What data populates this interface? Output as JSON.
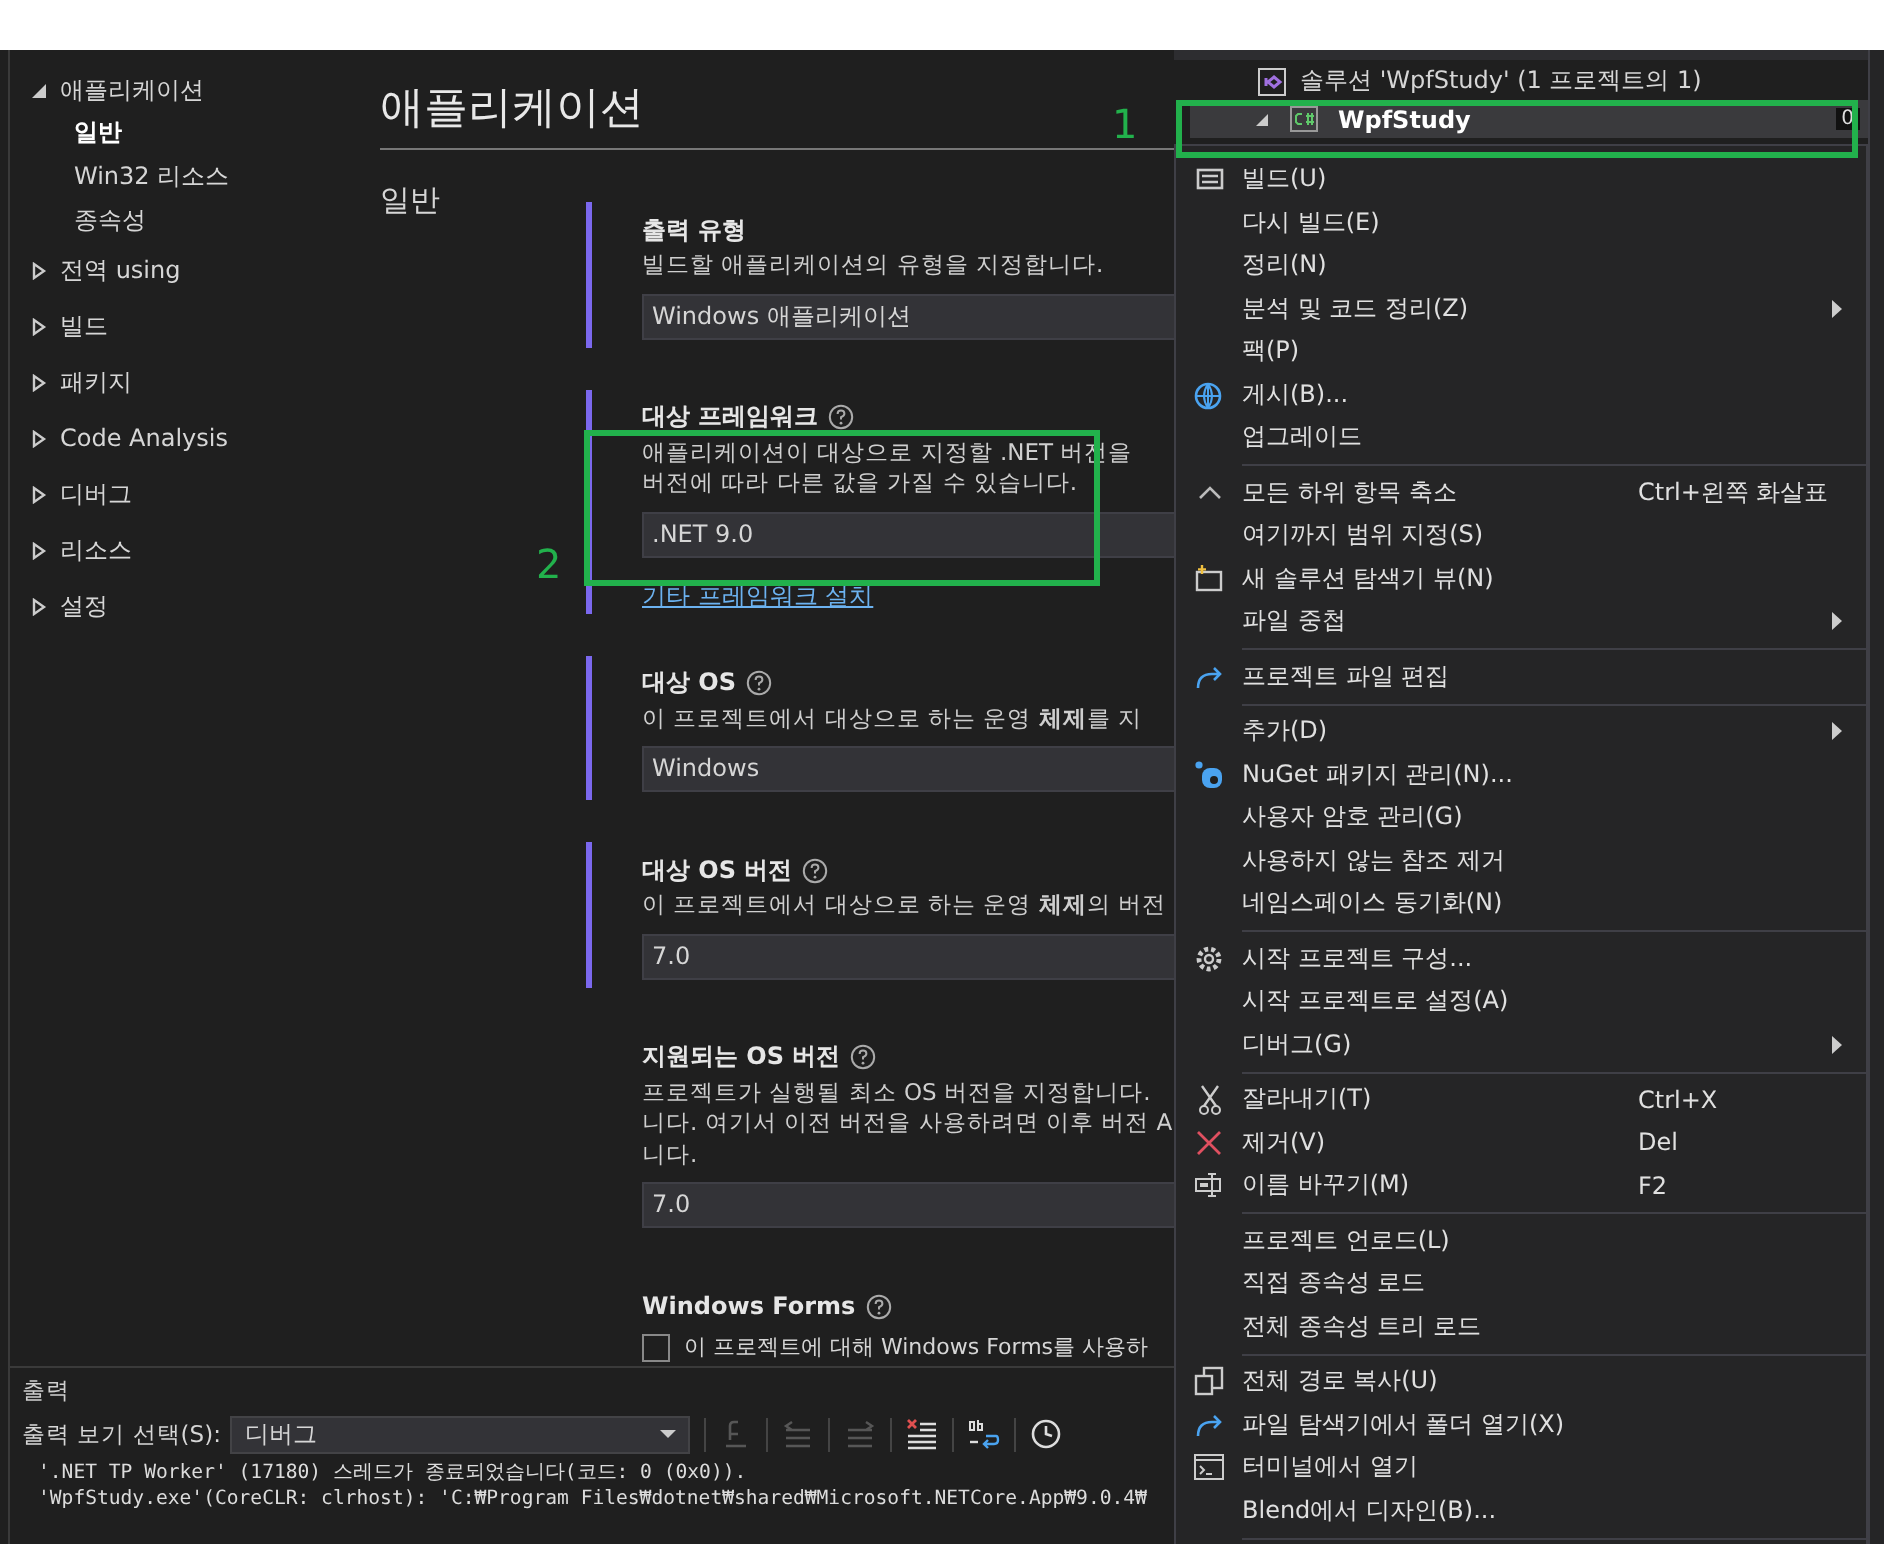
{
  "sidebar": {
    "items": [
      {
        "label": "애플리케이션",
        "expanded": true,
        "children": [
          {
            "label": "일반",
            "selected": true
          },
          {
            "label": "Win32 리소스",
            "selected": false
          },
          {
            "label": "종속성",
            "selected": false
          }
        ]
      },
      {
        "label": "전역 using",
        "expanded": false
      },
      {
        "label": "빌드",
        "expanded": false
      },
      {
        "label": "패키지",
        "expanded": false
      },
      {
        "label": "Code Analysis",
        "expanded": false
      },
      {
        "label": "디버그",
        "expanded": false
      },
      {
        "label": "리소스",
        "expanded": false
      },
      {
        "label": "설정",
        "expanded": false
      }
    ]
  },
  "page": {
    "title": "애플리케이션",
    "section": "일반",
    "groups": [
      {
        "kind": "select",
        "title": "출력 유형",
        "modified": true,
        "desc": [
          "빌드할 애플리케이션의 유형을 지정합니다."
        ],
        "value": "Windows 애플리케이션"
      },
      {
        "kind": "select",
        "title": "대상 프레임워크",
        "help": true,
        "modified": true,
        "desc": [
          "애플리케이션이 대상으로 지정할 .NET 버전을",
          "버전에 따라 다른 값을 가질 수 있습니다."
        ],
        "value": ".NET 9.0",
        "link": "기타 프레임워크 설치"
      },
      {
        "kind": "select",
        "title": "대상 OS",
        "help": true,
        "modified": true,
        "desc": [
          "이 프로젝트에서 대상으로 하는 운영 **체제**를 지"
        ],
        "value": "Windows"
      },
      {
        "kind": "select",
        "title": "대상 OS 버전",
        "help": true,
        "modified": true,
        "desc": [
          "이 프로젝트에서 대상으로 하는 운영 **체제**의 버전"
        ],
        "value": "7.0"
      },
      {
        "kind": "select",
        "title": "지원되는 OS 버전",
        "help": true,
        "modified": false,
        "desc": [
          "프로젝트가 실행될 최소 OS 버전을 지정합니다.",
          "니다. 여기서 이전 버전을 사용하려면 이후 버전 A",
          "니다."
        ],
        "value": "7.0"
      },
      {
        "kind": "checkbox",
        "title": "Windows Forms",
        "help": true,
        "modified": false,
        "checked": false,
        "label": "이 프로젝트에 대해 Windows Forms를 사용하"
      }
    ]
  },
  "output": {
    "title": "출력",
    "source_label": "출력 보기 선택(S):",
    "source": "디버그",
    "toolbar": [
      {
        "kind": "find",
        "disabled": true
      },
      {
        "kind": "prev",
        "disabled": true
      },
      {
        "kind": "next",
        "disabled": true
      },
      {
        "kind": "clear",
        "disabled": false
      },
      {
        "kind": "wrap",
        "disabled": false
      },
      {
        "kind": "clock",
        "disabled": false
      }
    ],
    "lines": [
      "'.NET TP Worker' (17180) 스레드가 종료되었습니다(코드: 0 (0x0)).",
      "'WpfStudy.exe'(CoreCLR: clrhost): 'C:₩Program Files₩dotnet₩shared₩Microsoft.NETCore.App₩9.0.4₩"
    ]
  },
  "solution_explorer": {
    "solution": "솔루션 'WpfStudy' (1 프로젝트의 1)",
    "project": "WpfStudy",
    "project_selected": true,
    "pending": "0"
  },
  "context_menu": [
    {
      "kind": "build",
      "label": "빌드(U)"
    },
    {
      "kind": "item",
      "label": "다시 빌드(E)"
    },
    {
      "kind": "item",
      "label": "정리(N)"
    },
    {
      "kind": "item",
      "label": "분석 및 코드 정리(Z)",
      "submenu": true
    },
    {
      "kind": "item",
      "label": "팩(P)"
    },
    {
      "kind": "globe",
      "label": "게시(B)..."
    },
    {
      "kind": "item",
      "label": "업그레이드"
    },
    {
      "kind": "separator"
    },
    {
      "kind": "caret",
      "label": "모든 하위 항목 축소",
      "shortcut": "Ctrl+왼쪽 화살표"
    },
    {
      "kind": "item",
      "label": "여기까지 범위 지정(S)"
    },
    {
      "kind": "newview",
      "label": "새 솔루션 탐색기 뷰(N)"
    },
    {
      "kind": "item",
      "label": "파일 중첩",
      "submenu": true
    },
    {
      "kind": "separator"
    },
    {
      "kind": "redo",
      "label": "프로젝트 파일 편집"
    },
    {
      "kind": "separator"
    },
    {
      "kind": "item",
      "label": "추가(D)",
      "submenu": true
    },
    {
      "kind": "nuget",
      "label": "NuGet 패키지 관리(N)..."
    },
    {
      "kind": "item",
      "label": "사용자 암호 관리(G)"
    },
    {
      "kind": "item",
      "label": "사용하지 않는 참조 제거"
    },
    {
      "kind": "item",
      "label": "네임스페이스 동기화(N)"
    },
    {
      "kind": "separator"
    },
    {
      "kind": "gear",
      "label": "시작 프로젝트 구성..."
    },
    {
      "kind": "item",
      "label": "시작 프로젝트로 설정(A)"
    },
    {
      "kind": "item",
      "label": "디버그(G)",
      "submenu": true
    },
    {
      "kind": "separator"
    },
    {
      "kind": "scissors",
      "label": "잘라내기(T)",
      "shortcut": "Ctrl+X"
    },
    {
      "kind": "remove",
      "label": "제거(V)",
      "shortcut": "Del"
    },
    {
      "kind": "rename",
      "label": "이름 바꾸기(M)",
      "shortcut": "F2"
    },
    {
      "kind": "separator"
    },
    {
      "kind": "item",
      "label": "프로젝트 언로드(L)"
    },
    {
      "kind": "item",
      "label": "직접 종속성 로드"
    },
    {
      "kind": "item",
      "label": "전체 종속성 트리 로드"
    },
    {
      "kind": "separator"
    },
    {
      "kind": "copy",
      "label": "전체 경로 복사(U)"
    },
    {
      "kind": "redo",
      "label": "파일 탐색기에서 폴더 열기(X)"
    },
    {
      "kind": "terminal",
      "label": "터미널에서 열기"
    },
    {
      "kind": "item",
      "label": "Blend에서 디자인(B)..."
    },
    {
      "kind": "separator"
    }
  ],
  "annotations": [
    {
      "label": "1"
    },
    {
      "label": "2"
    }
  ]
}
